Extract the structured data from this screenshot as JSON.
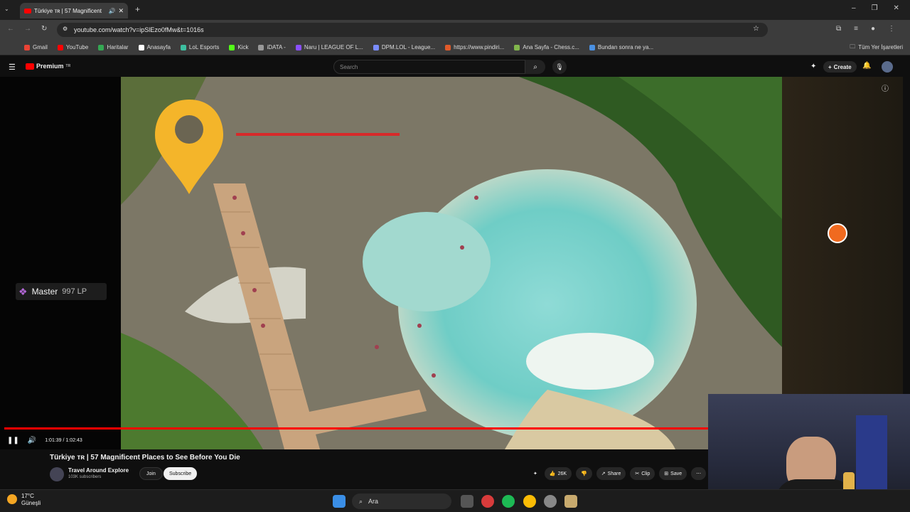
{
  "browser": {
    "tab_title": "Türkiye ᴛʀ | 57 Magnificent",
    "url": "youtube.com/watch?v=ipSlEzo0fMw&t=1016s",
    "bookmarks": [
      {
        "label": "Gmail",
        "color": "#ea4335"
      },
      {
        "label": "YouTube",
        "color": "#ff0000"
      },
      {
        "label": "Haritalar",
        "color": "#34a853"
      },
      {
        "label": "Anasayfa",
        "color": "#ffffff"
      },
      {
        "label": "LoL Esports",
        "color": "#3dbfa0"
      },
      {
        "label": "Kick",
        "color": "#53fc18"
      },
      {
        "label": "iDATA -",
        "color": "#999999"
      },
      {
        "label": "Naru | LEAGUE OF L...",
        "color": "#8a4fff"
      },
      {
        "label": "DPM.LOL - League...",
        "color": "#7a8cff"
      },
      {
        "label": "https://www.pindiri...",
        "color": "#e05a2a"
      },
      {
        "label": "Ana Sayfa - Chess.c...",
        "color": "#81b64c"
      },
      {
        "label": "Bundan sonra ne ya...",
        "color": "#4a90e2"
      }
    ],
    "all_bookmarks": "Tüm Yer İşaretleri"
  },
  "youtube": {
    "logo_text": "Premium",
    "logo_sup": "TR",
    "search_placeholder": "Search",
    "create_label": "Create"
  },
  "player": {
    "time": "1:01:39 / 1:02:43",
    "progress_fraction": 0.983
  },
  "overlay": {
    "rank": "Master",
    "lp": "997 LP"
  },
  "video": {
    "title": "Türkiye ᴛʀ | 57 Magnificent Places to See Before You Die",
    "channel": "Travel Around Explore",
    "subscribers": "103K subscribers",
    "join_label": "Join",
    "subscribe_label": "Subscribe",
    "likes": "26K",
    "share_label": "Share",
    "clip_label": "Clip",
    "save_label": "Save"
  },
  "taskbar": {
    "temp": "17°C",
    "weather": "Güneşli",
    "search_label": "Ara"
  }
}
